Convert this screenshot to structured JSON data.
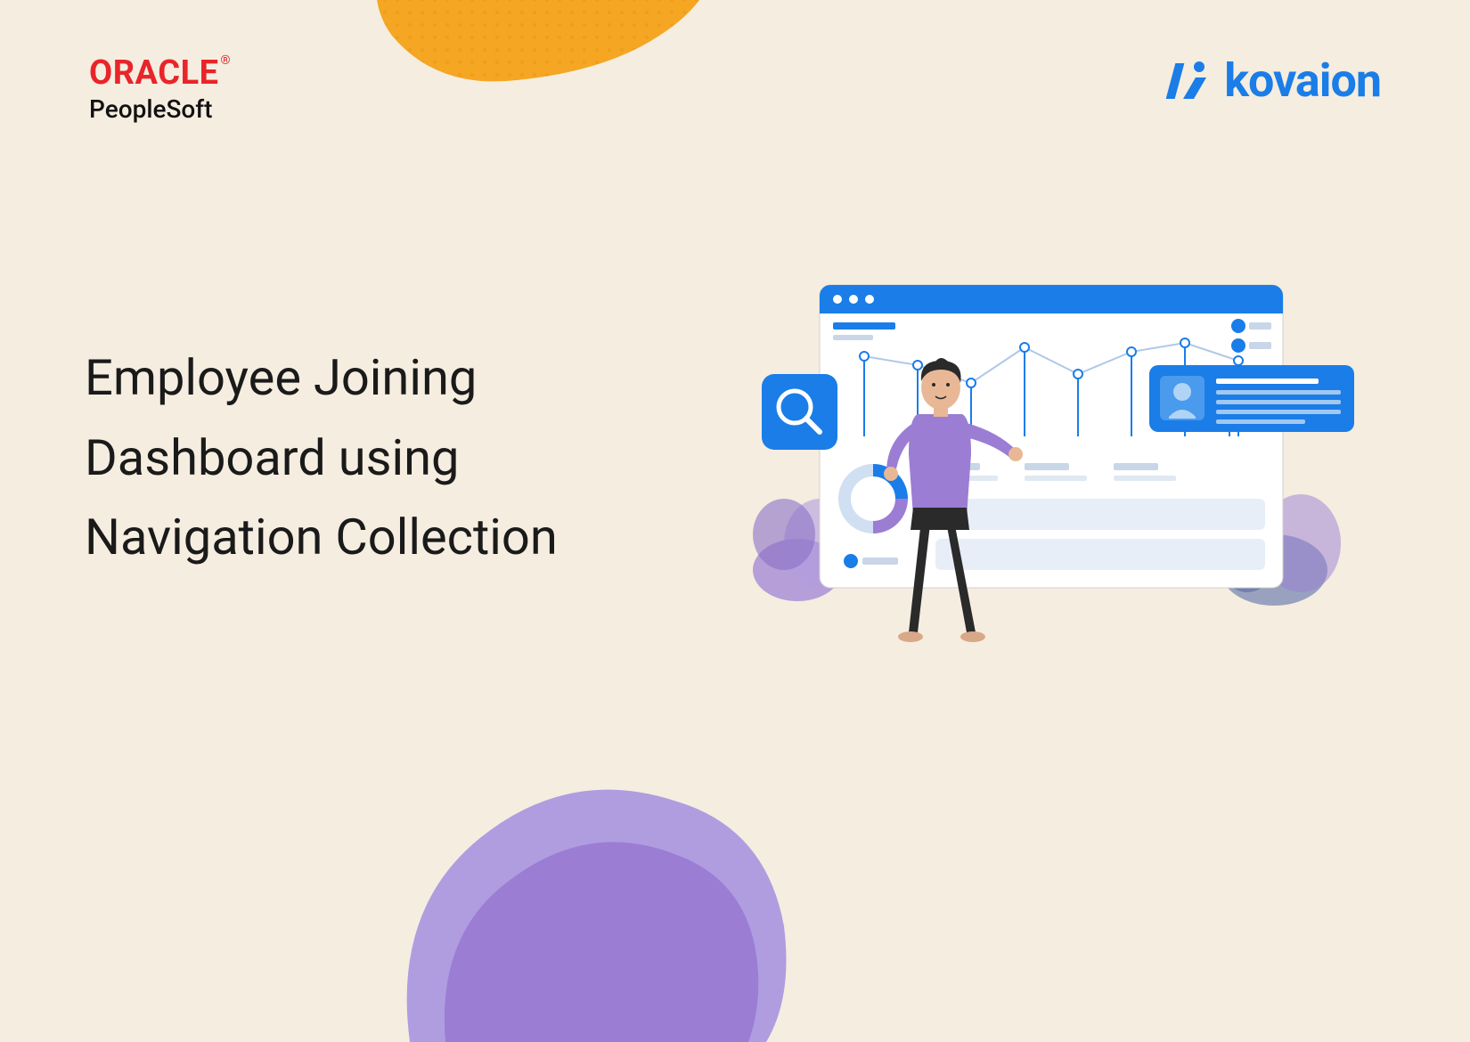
{
  "logos": {
    "oracle": {
      "main": "ORACLE",
      "reg": "®",
      "sub": "PeopleSoft"
    },
    "kovaion": {
      "text": "kovaion"
    }
  },
  "heading": {
    "line1": "Employee Joining",
    "line2": "Dashboard using",
    "line3": "Navigation Collection"
  },
  "colors": {
    "background": "#f5ede0",
    "orange": "#f5a623",
    "purple": "#9b7dd4",
    "blue": "#1a7de8",
    "red": "#e8252a"
  }
}
